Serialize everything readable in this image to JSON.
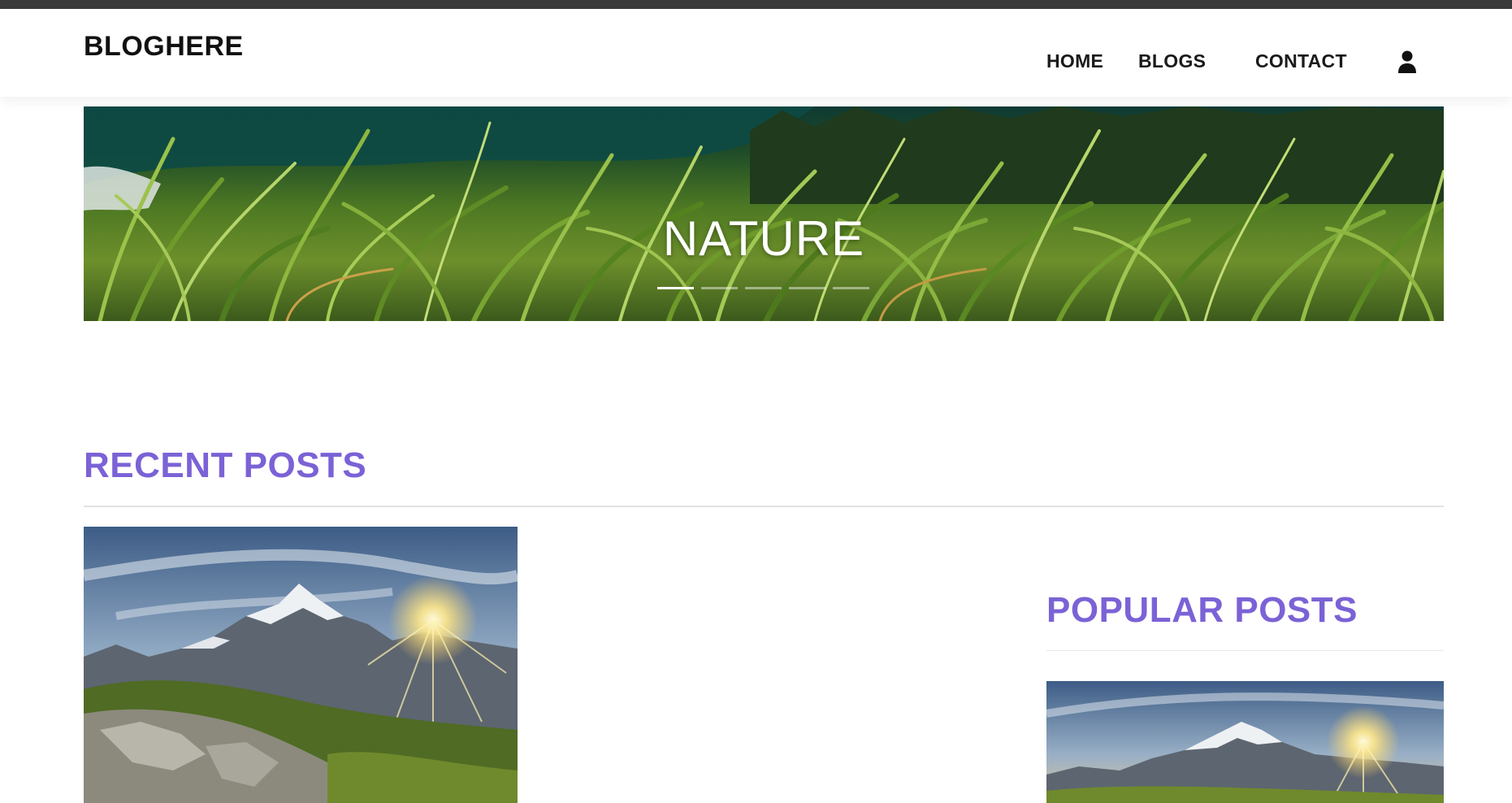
{
  "navbar": {
    "brand": "BLOGHERE",
    "links": [
      {
        "label": "HOME"
      },
      {
        "label": "BLOGS"
      },
      {
        "label": "CONTACT"
      }
    ],
    "account_icon": "user-icon"
  },
  "hero": {
    "title": "NATURE",
    "slide_count": 5,
    "active_slide": 1
  },
  "recent_posts": {
    "heading": "RECENT POSTS"
  },
  "popular_posts": {
    "heading": "POPULAR POSTS"
  },
  "colors": {
    "accent": "#7b62d6",
    "nav_text": "#1a1a1a",
    "top_strip": "#3a3a3a"
  }
}
